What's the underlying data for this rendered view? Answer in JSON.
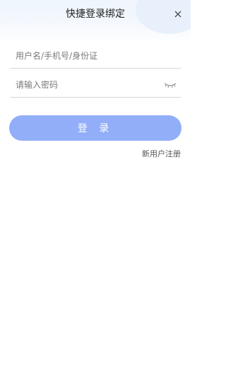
{
  "header": {
    "title": "快捷登录绑定",
    "close_icon": "close-icon"
  },
  "form": {
    "username_placeholder": "用户名/手机号/身份证",
    "username_value": "",
    "password_placeholder": "请输入密码",
    "password_value": "",
    "password_toggle_icon": "eye-closed-icon",
    "login_label": "登 录",
    "register_label": "新用户注册"
  },
  "colors": {
    "primary_button": "#93aef8",
    "header_background": "#eef5fd"
  }
}
